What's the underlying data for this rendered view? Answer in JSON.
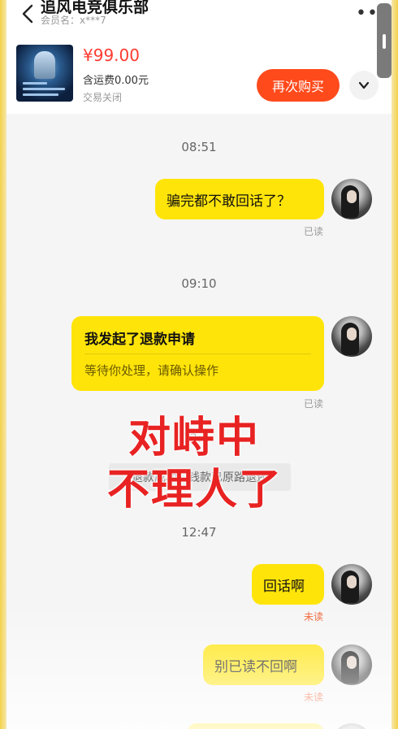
{
  "header": {
    "shop_name": "追风电竞俱乐部",
    "member_label": "会员名：x***7",
    "more_icon": "•••"
  },
  "product": {
    "price": "¥99.00",
    "shipping": "含运费0.00元",
    "status": "交易关闭",
    "rebuy_label": "再次购买"
  },
  "chat": {
    "time1": "08:51",
    "msg1": "骗完都不敢回话了？",
    "msg1_status": "已读",
    "time2": "09:10",
    "card_title": "我发起了退款申请",
    "card_sub": "等待你处理，请确认操作",
    "card_status": "已读",
    "time3_hidden": "12:",
    "sys_msg": "退款成功，钱款已原路退还",
    "time4": "12:47",
    "msg3": "回话啊",
    "msg3_status": "未读",
    "msg4": "别已读不回啊",
    "msg4_status": "未读"
  },
  "overlay": {
    "line1": "对峙中",
    "line2": "不理人了"
  },
  "colors": {
    "bubble": "#ffe40a",
    "price": "#ff3b30",
    "rebuy": "#ff4a1c",
    "overlay": "#e82222",
    "unread": "#f25a2a"
  }
}
